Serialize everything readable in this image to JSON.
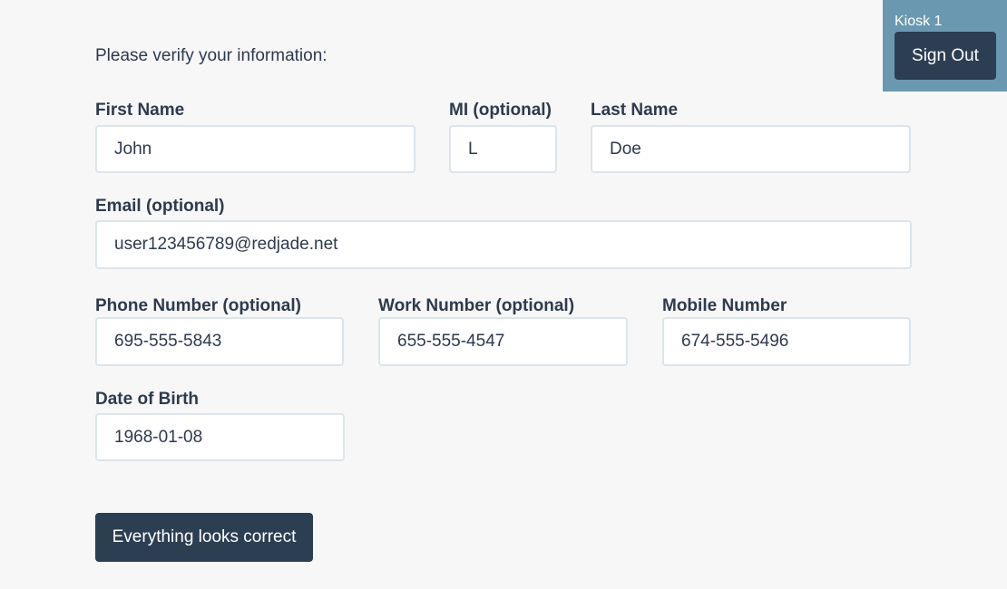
{
  "kiosk": {
    "label": "Kiosk 1",
    "sign_out_label": "Sign Out"
  },
  "intro_text": "Please verify your information:",
  "form": {
    "first_name": {
      "label": "First Name",
      "value": "John"
    },
    "middle_initial": {
      "label": "MI (optional)",
      "value": "L"
    },
    "last_name": {
      "label": "Last Name",
      "value": "Doe"
    },
    "email": {
      "label": "Email (optional)",
      "value": "user123456789@redjade.net"
    },
    "phone": {
      "label": "Phone Number (optional)",
      "value": "695-555-5843"
    },
    "work": {
      "label": "Work Number (optional)",
      "value": "655-555-4547"
    },
    "mobile": {
      "label": "Mobile Number",
      "value": "674-555-5496"
    },
    "dob": {
      "label": "Date of Birth",
      "value": "1968-01-08"
    }
  },
  "confirm_label": "Everything looks correct",
  "colors": {
    "background": "#f7f7f7",
    "kiosk_panel": "#6a98b1",
    "button_dark": "#2c3e52",
    "text": "#2e3a4d",
    "input_border": "#dde4ea"
  }
}
